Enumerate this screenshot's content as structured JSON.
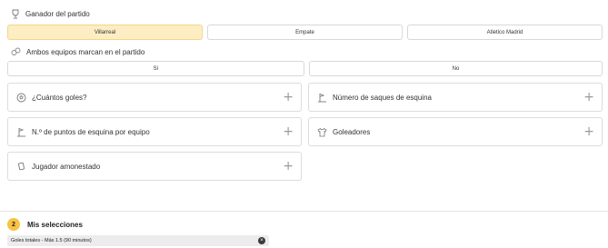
{
  "winner": {
    "title": "Ganador del partido",
    "options": [
      "Villarreal",
      "Empate",
      "Atletico Madrid"
    ],
    "selected": 0
  },
  "btts": {
    "title": "Ambos equipos marcan en el partido",
    "options": [
      "Sí",
      "No"
    ]
  },
  "markets": [
    {
      "label": "¿Cuántos goles?",
      "icon": "soccer-ball-icon"
    },
    {
      "label": "Número de saques de esquina",
      "icon": "corner-flag-icon"
    },
    {
      "label": "N.º de puntos de esquina por equipo",
      "icon": "corner-flag-icon"
    },
    {
      "label": "Goleadores",
      "icon": "shirt-icon"
    },
    {
      "label": "Jugador amonestado",
      "icon": "card-icon"
    }
  ],
  "betslip": {
    "count": "2",
    "title": "Mis selecciones",
    "item": "Goles totales - Más 1.5 (90 minutos)"
  },
  "colors": {
    "selected_bg": "#fdedc2",
    "badge": "#f6c343"
  }
}
